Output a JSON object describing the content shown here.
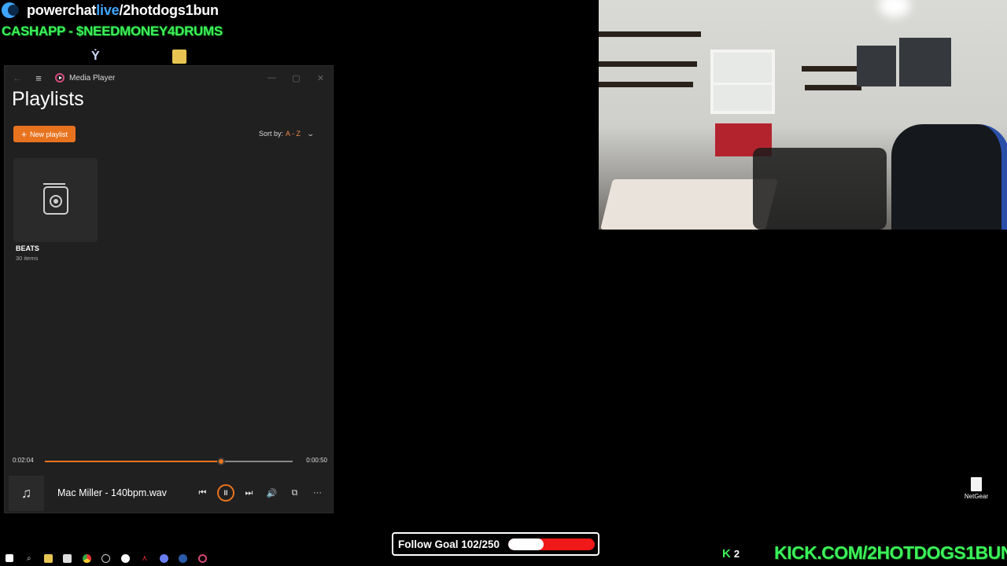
{
  "overlay": {
    "brand_a": "powerchat",
    "brand_b": "live",
    "brand_c": "/2hotdogs1bun",
    "cashapp": "CASHAPP - $NEEDMONEY4DRUMS",
    "follow_goal_text": "Follow Goal 102/250",
    "follow_goal_fraction": 0.408,
    "kick_count": "2",
    "kick_icon": "K",
    "kick_url": "KICK.COM/2HOTDOGS1BUN"
  },
  "media_player": {
    "app_title": "Media Player",
    "page_title": "Playlists",
    "new_playlist_label": "New playlist",
    "sort_label": "Sort by:",
    "sort_value": "A - Z",
    "playlists": [
      {
        "name": "BEATS",
        "count": "30 items",
        "icon": "playlist-speaker-icon"
      }
    ],
    "time_current": "0:02:04",
    "time_total": "0:00:50",
    "progress_fraction": 0.71,
    "now_playing_title": "Mac Miller - 140bpm.wav",
    "controls": {
      "previous": "⏮",
      "pause": "II",
      "next": "⏭",
      "volume": "🔊",
      "miniplayer": "⧉",
      "more": "···"
    }
  },
  "desktop": {
    "netgear_label": "NetGear"
  },
  "colors": {
    "accent_orange": "#e8731f",
    "kick_green": "#3cf25a",
    "goal_red": "#f01818",
    "brand_blue": "#41a5ff"
  },
  "taskbar": {
    "items": [
      "windows-start-icon",
      "search-icon",
      "file-explorer-icon",
      "app-icon",
      "chrome-icon",
      "obs-icon",
      "white-circle-app-icon",
      "app-red-icon",
      "discord-icon",
      "steam-icon",
      "media-player-icon"
    ]
  }
}
